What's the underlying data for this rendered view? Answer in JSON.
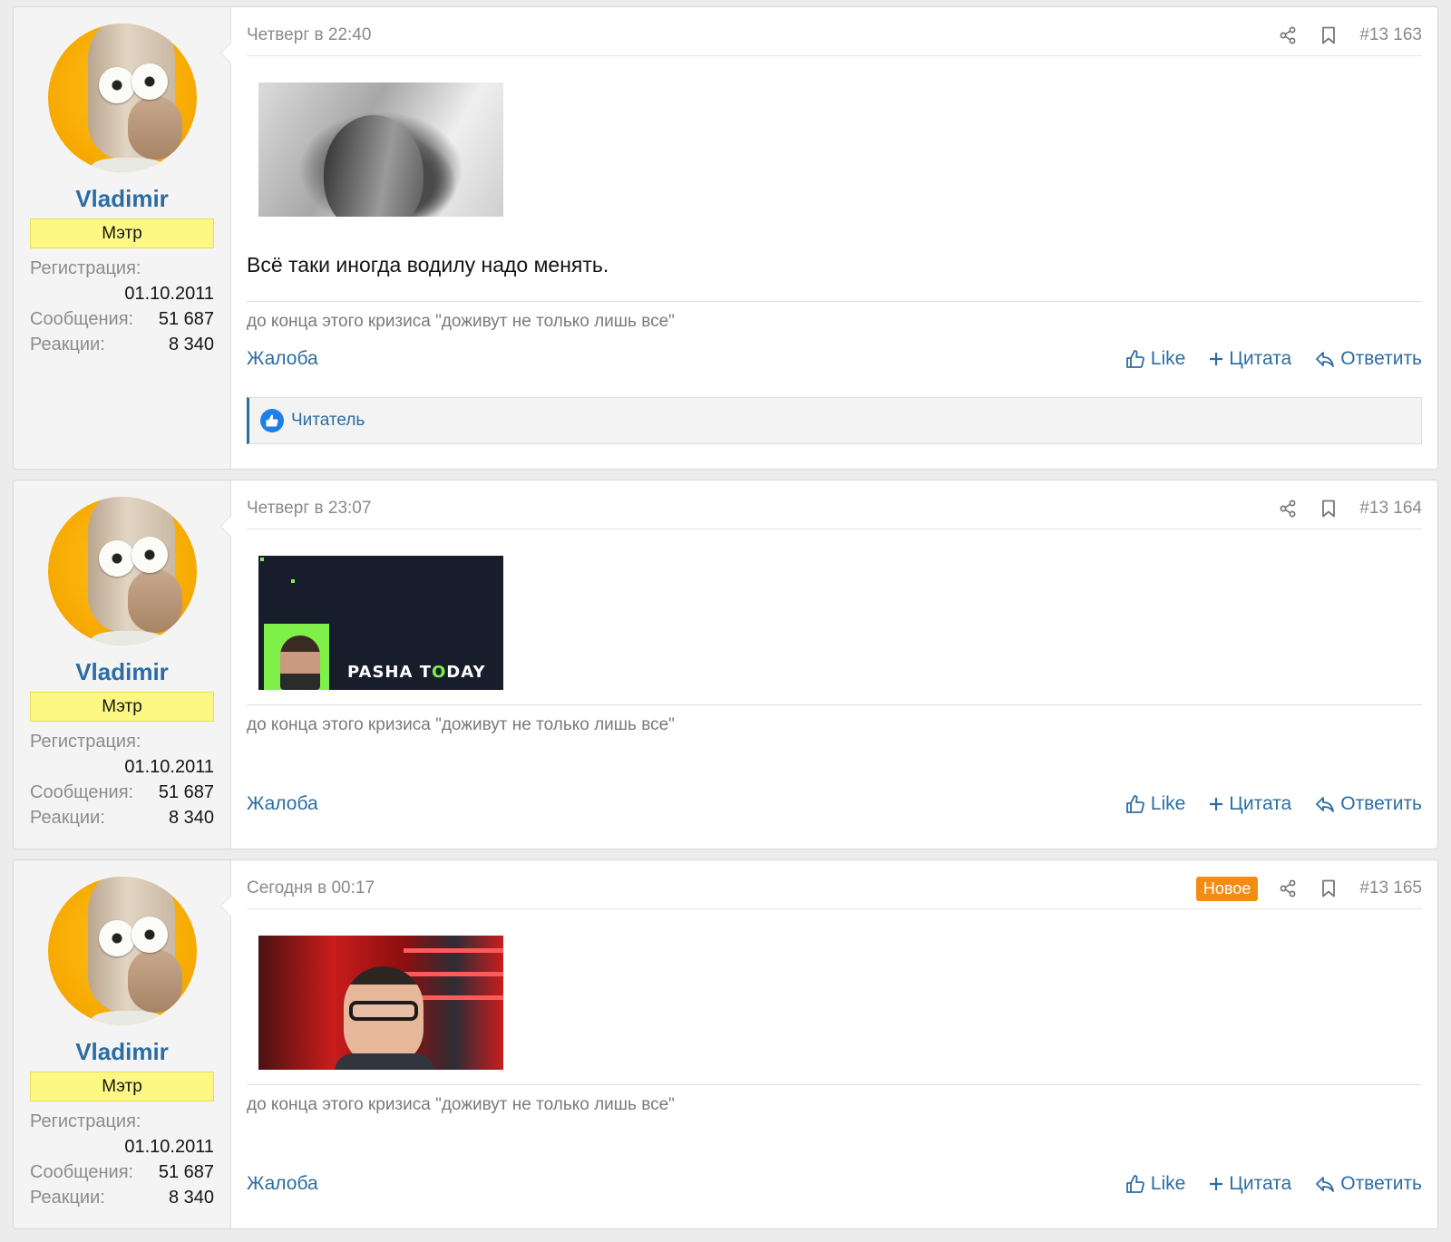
{
  "colors": {
    "accent": "#2c6ca3",
    "rank_bg": "#fdf884",
    "new_badge": "#f28c13"
  },
  "posts": [
    {
      "username": "Vladimir",
      "rank": "Мэтр",
      "reg_label": "Регистрация:",
      "reg_date": "01.10.2011",
      "msgs_label": "Сообщения:",
      "msgs": "51 687",
      "reactions_label": "Реакции:",
      "reactions": "8 340",
      "date": "Четверг в 22:40",
      "number": "#13 163",
      "body": "Всё таки иногда водилу надо менять.",
      "signature": "до конца этого кризиса \"доживут не только лишь все\"",
      "report": "Жалоба",
      "like": "Like",
      "quote": "Цитата",
      "reply": "Ответить",
      "reactor": "Читатель"
    },
    {
      "username": "Vladimir",
      "rank": "Мэтр",
      "reg_label": "Регистрация:",
      "reg_date": "01.10.2011",
      "msgs_label": "Сообщения:",
      "msgs": "51 687",
      "reactions_label": "Реакции:",
      "reactions": "8 340",
      "date": "Четверг в 23:07",
      "number": "#13 164",
      "image_logo_a": "PASHA T",
      "image_logo_b": "O",
      "image_logo_c": "DAY",
      "signature": "до конца этого кризиса \"доживут не только лишь все\"",
      "report": "Жалоба",
      "like": "Like",
      "quote": "Цитата",
      "reply": "Ответить"
    },
    {
      "username": "Vladimir",
      "rank": "Мэтр",
      "reg_label": "Регистрация:",
      "reg_date": "01.10.2011",
      "msgs_label": "Сообщения:",
      "msgs": "51 687",
      "reactions_label": "Реакции:",
      "reactions": "8 340",
      "date": "Сегодня в 00:17",
      "badge": "Новое",
      "number": "#13 165",
      "signature": "до конца этого кризиса \"доживут не только лишь все\"",
      "report": "Жалоба",
      "like": "Like",
      "quote": "Цитата",
      "reply": "Ответить"
    }
  ]
}
